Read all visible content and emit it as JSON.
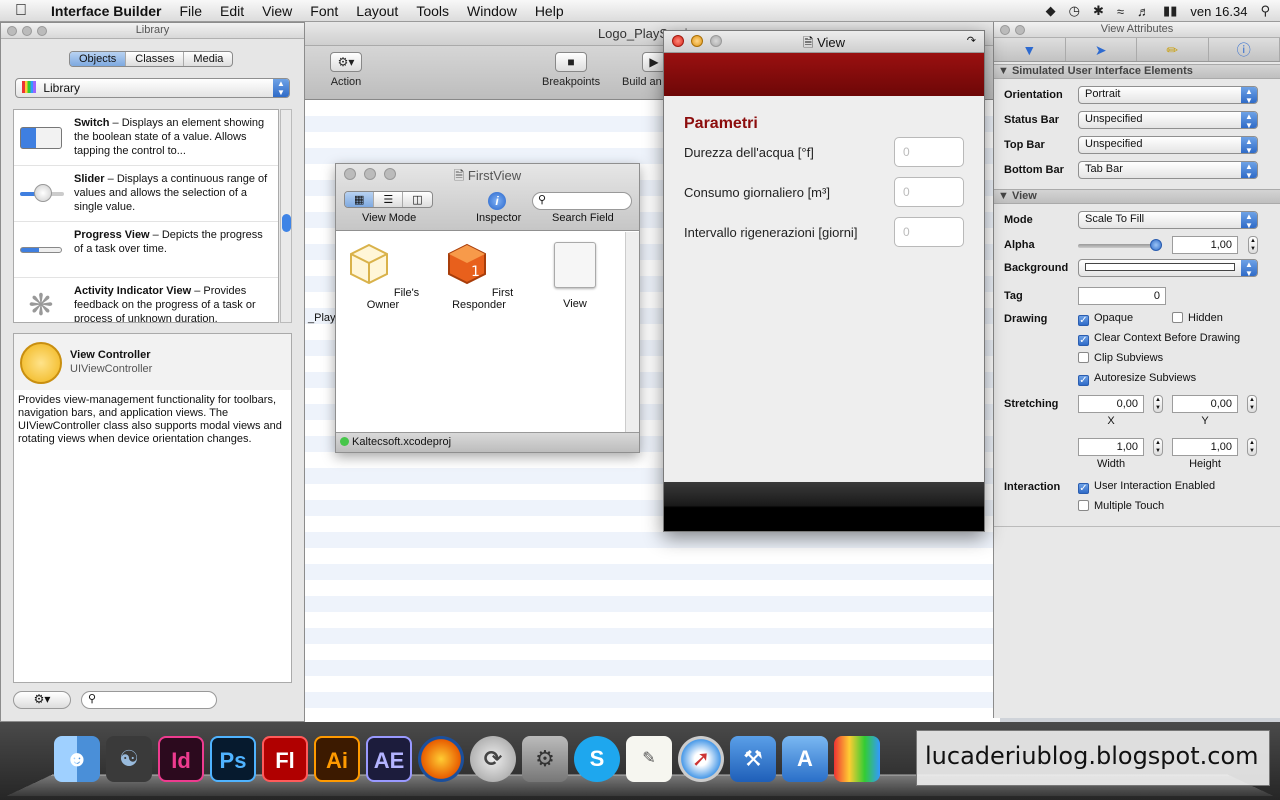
{
  "menubar": {
    "app": "Interface Builder",
    "items": [
      "File",
      "Edit",
      "View",
      "Font",
      "Layout",
      "Tools",
      "Window",
      "Help"
    ],
    "clock": "ven 16.34"
  },
  "background_window": {
    "title": "Logo_PlaySys.jpg",
    "toolbar": {
      "action": "Action",
      "breakpoints": "Breakpoints",
      "build": "Build an"
    },
    "list_fragment": "_PlayS"
  },
  "library": {
    "title": "Library",
    "tabs": [
      "Objects",
      "Classes",
      "Media"
    ],
    "selected_tab": "Objects",
    "popup": "Library",
    "items": [
      {
        "name": "Switch",
        "desc": "Displays an element showing the boolean state of a value. Allows tapping the control to..."
      },
      {
        "name": "Slider",
        "desc": "Displays a continuous range of values and allows the selection of a single value."
      },
      {
        "name": "Progress View",
        "desc": "Depicts the progress of a task over time."
      },
      {
        "name": "Activity Indicator View",
        "desc": "Provides feedback on the progress of a task or process of unknown duration."
      }
    ],
    "detail": {
      "title": "View Controller",
      "class": "UIViewController",
      "description": "Provides view-management functionality for toolbars, navigation bars, and application views. The UIViewController class also supports modal views and rotating views when device orientation changes."
    }
  },
  "firstview": {
    "title": "FirstView",
    "toolbar": {
      "view_mode": "View Mode",
      "inspector": "Inspector",
      "search_field": "Search Field"
    },
    "objects": [
      "File's Owner",
      "First Responder",
      "View"
    ],
    "status": "Kaltecsoft.xcodeproj"
  },
  "view_window": {
    "title": "View",
    "heading": "Parametri",
    "rows": [
      {
        "label": "Durezza dell'acqua [°f]",
        "placeholder": "0"
      },
      {
        "label": "Consumo giornaliero [m³]",
        "placeholder": "0"
      },
      {
        "label": "Intervallo rigenerazioni [giorni]",
        "placeholder": "0"
      }
    ]
  },
  "inspector": {
    "title": "View Attributes",
    "section_simulated": "Simulated User Interface Elements",
    "orientation": {
      "label": "Orientation",
      "value": "Portrait"
    },
    "status_bar": {
      "label": "Status Bar",
      "value": "Unspecified"
    },
    "top_bar": {
      "label": "Top Bar",
      "value": "Unspecified"
    },
    "bottom_bar": {
      "label": "Bottom Bar",
      "value": "Tab Bar"
    },
    "section_view": "View",
    "mode": {
      "label": "Mode",
      "value": "Scale To Fill"
    },
    "alpha": {
      "label": "Alpha",
      "value": "1,00",
      "level": 1.0
    },
    "background": {
      "label": "Background",
      "color": "#ffffff"
    },
    "tag": {
      "label": "Tag",
      "value": "0"
    },
    "drawing": {
      "label": "Drawing",
      "opaque": "Opaque",
      "hidden": "Hidden",
      "clear_context": "Clear Context Before Drawing",
      "clip_subviews": "Clip Subviews",
      "autoresize": "Autoresize Subviews"
    },
    "stretching": {
      "label": "Stretching",
      "x": "0,00",
      "y": "0,00",
      "width": "1,00",
      "height": "1,00",
      "x_label": "X",
      "y_label": "Y",
      "width_label": "Width",
      "height_label": "Height"
    },
    "interaction": {
      "label": "Interaction",
      "user_interaction": "User Interaction Enabled",
      "multiple_touch": "Multiple Touch"
    }
  },
  "dock": {
    "apps": [
      "Finder",
      "Growl",
      "InDesign",
      "Photoshop",
      "Flash",
      "Illustrator",
      "After Effects",
      "Firefox",
      "Time Machine",
      "System Preferences",
      "Skype",
      "TextEdit",
      "Safari",
      "Xcode",
      "App Store",
      "Instruments"
    ]
  },
  "watermark": "lucaderiublog.blogspot.com"
}
